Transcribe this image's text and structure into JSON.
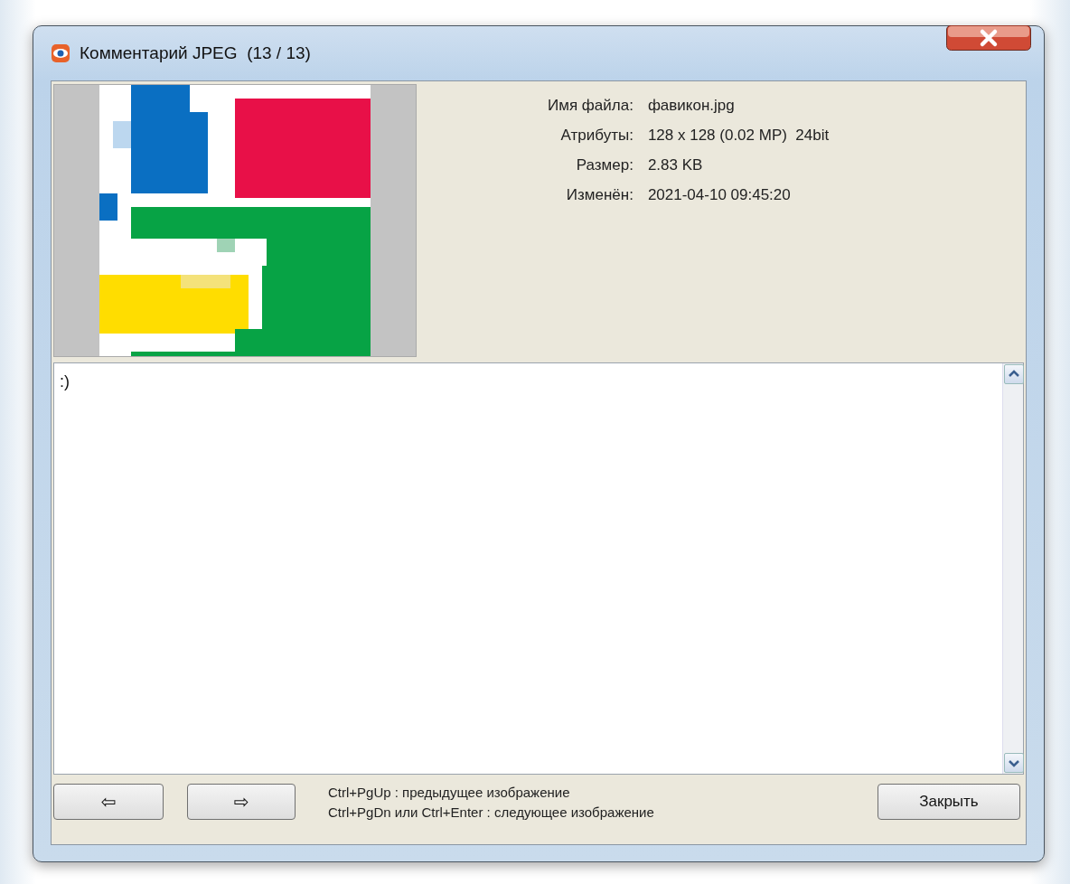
{
  "window": {
    "title": "Комментарий JPEG  (13 / 13)"
  },
  "info": [
    {
      "label": "Имя файла:",
      "value": "фавикон.jpg"
    },
    {
      "label": "Атрибуты:",
      "value": "128 x 128 (0.02 MP)  24bit"
    },
    {
      "label": "Размер:",
      "value": "2.83 KB"
    },
    {
      "label": "Изменён:",
      "value": "2021-04-10 09:45:20"
    }
  ],
  "comment": {
    "value": ":)"
  },
  "nav_buttons": [
    "⇦",
    "⇨"
  ],
  "hints": [
    "Ctrl+PgUp : предыдущее изображение",
    "Ctrl+PgDn или Ctrl+Enter : следующее изображение"
  ],
  "close_button": {
    "label": "Закрыть"
  }
}
